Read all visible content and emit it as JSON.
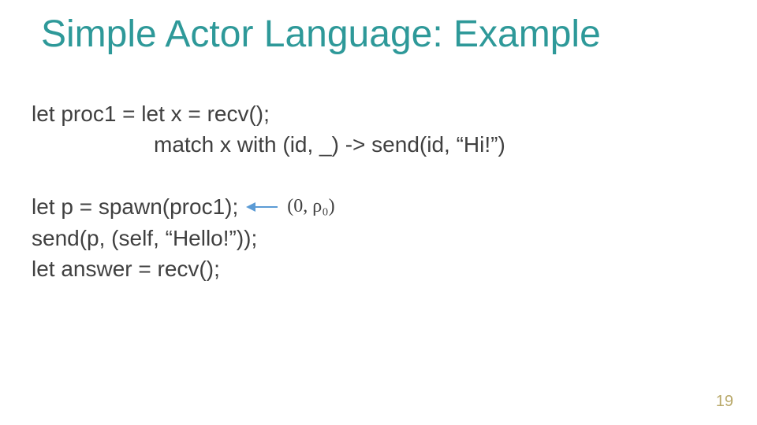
{
  "title": "Simple Actor Language: Example",
  "code": {
    "line1": "let proc1 = let x = recv();",
    "line2": "match x with (id, _) -> send(id, “Hi!”)",
    "line3": "let p = spawn(proc1);",
    "line4": "send(p, (self, “Hello!”));",
    "line5": "let answer = recv();"
  },
  "annotation": "(0, ρ₀)",
  "page_number": "19"
}
